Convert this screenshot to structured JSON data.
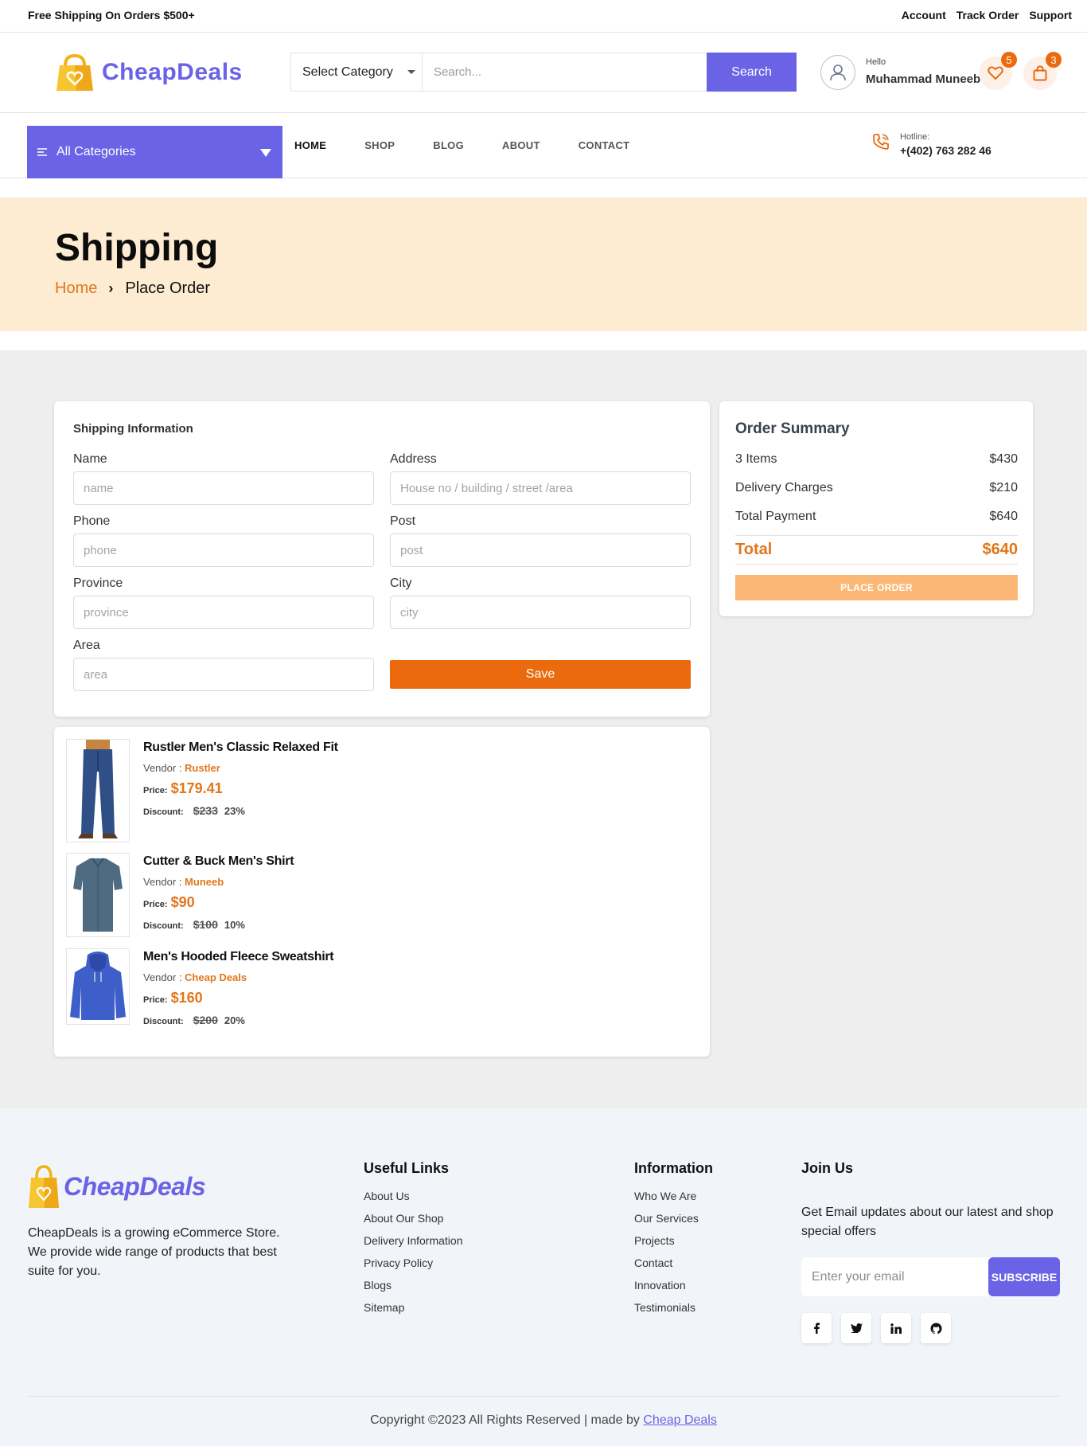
{
  "topbar": {
    "shipping_note": "Free Shipping On Orders $500+",
    "links": [
      "Account",
      "Track Order",
      "Support"
    ]
  },
  "header": {
    "logo_text": "CheapDeals",
    "category_select": "Select Category",
    "search_placeholder": "Search...",
    "search_button": "Search",
    "greeting": "Hello",
    "user_name": "Muhammad Muneeb",
    "wishlist_count": "5",
    "cart_count": "3"
  },
  "nav": {
    "all_categories": "All Categories",
    "menu": [
      "HOME",
      "SHOP",
      "BLOG",
      "ABOUT",
      "CONTACT"
    ],
    "active": "HOME",
    "hotline_label": "Hotline:",
    "hotline_number": "+(402) 763 282 46"
  },
  "banner": {
    "title": "Shipping",
    "breadcrumb_home": "Home",
    "breadcrumb_sep": "›",
    "breadcrumb_current": "Place Order"
  },
  "shipping_form": {
    "title": "Shipping Information",
    "name_label": "Name",
    "name_placeholder": "name",
    "address_label": "Address",
    "address_placeholder": "House no / building / street /area",
    "phone_label": "Phone",
    "phone_placeholder": "phone",
    "post_label": "Post",
    "post_placeholder": "post",
    "province_label": "Province",
    "province_placeholder": "province",
    "city_label": "City",
    "city_placeholder": "city",
    "area_label": "Area",
    "area_placeholder": "area",
    "save_button": "Save"
  },
  "items": [
    {
      "name": "Rustler Men's Classic Relaxed Fit",
      "vendor_label": "Vendor : ",
      "vendor": "Rustler",
      "price_label": "Price:",
      "price": "$179.41",
      "discount_label": "Discount:",
      "old_price": "$233",
      "discount_pct": "23%",
      "image": "jeans"
    },
    {
      "name": "Cutter & Buck Men's Shirt",
      "vendor_label": "Vendor : ",
      "vendor": "Muneeb",
      "price_label": "Price:",
      "price": "$90",
      "discount_label": "Discount:",
      "old_price": "$100",
      "discount_pct": "10%",
      "image": "shirt"
    },
    {
      "name": "Men's Hooded Fleece Sweatshirt",
      "vendor_label": "Vendor : ",
      "vendor": "Cheap Deals",
      "price_label": "Price:",
      "price": "$160",
      "discount_label": "Discount:",
      "old_price": "$200",
      "discount_pct": "20%",
      "image": "hoodie"
    }
  ],
  "order_summary": {
    "title": "Order Summary",
    "rows": [
      {
        "label": "3 Items",
        "value": "$430"
      },
      {
        "label": "Delivery Charges",
        "value": "$210"
      },
      {
        "label": "Total Payment",
        "value": "$640"
      }
    ],
    "total_label": "Total",
    "total_value": "$640",
    "place_order_button": "PLACE ORDER"
  },
  "footer": {
    "logo_text": "CheapDeals",
    "description": "CheapDeals is a growing eCommerce Store. We provide wide range of products that best suite for you.",
    "useful_links_title": "Useful Links",
    "useful_links": [
      "About Us",
      "About Our Shop",
      "Delivery Information",
      "Privacy Policy",
      "Blogs",
      "Sitemap"
    ],
    "information_title": "Information",
    "information_links": [
      "Who We Are",
      "Our Services",
      "Projects",
      "Contact",
      "Innovation",
      "Testimonials"
    ],
    "join_title": "Join Us",
    "join_text": "Get Email updates about our latest and shop special offers",
    "email_placeholder": "Enter your email",
    "subscribe_button": "SUBSCRIBE",
    "social": [
      "facebook-icon",
      "twitter-icon",
      "linkedin-icon",
      "github-icon"
    ],
    "copyright": "Copyright ©2023 All Rights Reserved | made by ",
    "made_by": "Cheap Deals"
  },
  "colors": {
    "brand": "#6a63e6",
    "accent": "#ea6a0d",
    "banner_bg": "#fdebd2",
    "place_order_bg": "#fbb775"
  }
}
